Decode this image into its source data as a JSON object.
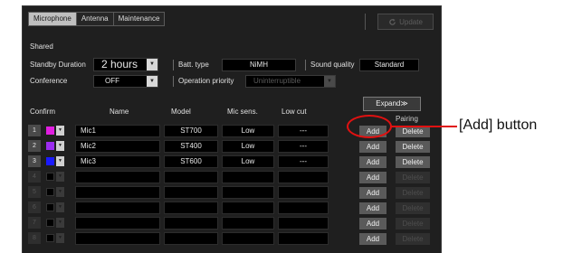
{
  "tabs": [
    {
      "label": "Microphone",
      "active": true
    },
    {
      "label": "Antenna",
      "active": false
    },
    {
      "label": "Maintenance",
      "active": false
    }
  ],
  "update_label": "Update",
  "shared": {
    "section_label": "Shared",
    "standby_label": "Standby Duration",
    "standby_value": "2 hours",
    "batt_label": "Batt. type",
    "batt_value": "NiMH",
    "sound_quality_label": "Sound quality",
    "sound_quality_value": "Standard",
    "conference_label": "Conference",
    "conference_value": "OFF",
    "op_priority_label": "Operation priority",
    "op_priority_value": "Uninterruptible"
  },
  "expand_label": "Expand≫",
  "pairing_label": "Pairing",
  "columns": {
    "confirm": "Confirm",
    "name": "Name",
    "model": "Model",
    "mic_sens": "Mic sens.",
    "low_cut": "Low cut"
  },
  "rows": [
    {
      "num": "1",
      "color": "#e01ee0",
      "name": "Mic1",
      "model": "ST700",
      "sens": "Low",
      "lowcut": "---",
      "add": "Add",
      "delete": "Delete",
      "active": true
    },
    {
      "num": "2",
      "color": "#9b2cf0",
      "name": "Mic2",
      "model": "ST400",
      "sens": "Low",
      "lowcut": "---",
      "add": "Add",
      "delete": "Delete",
      "active": true
    },
    {
      "num": "3",
      "color": "#1a1aff",
      "name": "Mic3",
      "model": "ST600",
      "sens": "Low",
      "lowcut": "---",
      "add": "Add",
      "delete": "Delete",
      "active": true
    },
    {
      "num": "4",
      "color": "",
      "name": "",
      "model": "",
      "sens": "",
      "lowcut": "",
      "add": "Add",
      "delete": "Delete",
      "active": false
    },
    {
      "num": "5",
      "color": "",
      "name": "",
      "model": "",
      "sens": "",
      "lowcut": "",
      "add": "Add",
      "delete": "Delete",
      "active": false
    },
    {
      "num": "6",
      "color": "",
      "name": "",
      "model": "",
      "sens": "",
      "lowcut": "",
      "add": "Add",
      "delete": "Delete",
      "active": false
    },
    {
      "num": "7",
      "color": "",
      "name": "",
      "model": "",
      "sens": "",
      "lowcut": "",
      "add": "Add",
      "delete": "Delete",
      "active": false
    },
    {
      "num": "8",
      "color": "",
      "name": "",
      "model": "",
      "sens": "",
      "lowcut": "",
      "add": "Add",
      "delete": "Delete",
      "active": false
    }
  ],
  "callout_label": "[Add] button",
  "callout_color": "#e01111"
}
